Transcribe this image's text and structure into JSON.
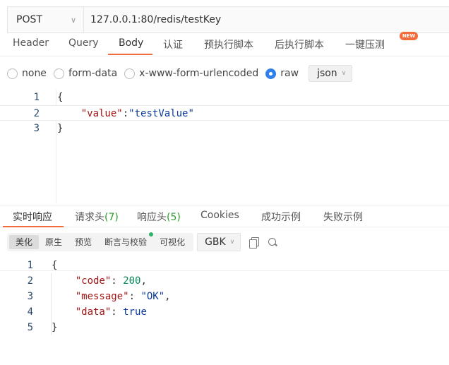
{
  "request": {
    "method": "POST",
    "url": "127.0.0.1:80/redis/testKey"
  },
  "request_tabs": [
    {
      "label": "Header"
    },
    {
      "label": "Query"
    },
    {
      "label": "Body"
    },
    {
      "label": "认证"
    },
    {
      "label": "预执行脚本"
    },
    {
      "label": "后执行脚本"
    },
    {
      "label": "一键压测"
    }
  ],
  "new_badge": "NEW",
  "body_types": [
    {
      "label": "none"
    },
    {
      "label": "form-data"
    },
    {
      "label": "x-www-form-urlencoded"
    },
    {
      "label": "raw"
    }
  ],
  "body_format": "json",
  "request_body_lines": [
    "1",
    "2",
    "3"
  ],
  "request_body": {
    "open": "{",
    "key": "\"value\"",
    "colon": ":",
    "value": "\"testValue\"",
    "close": "}"
  },
  "response_tabs": {
    "realtime": "实时响应",
    "req_headers": "请求头",
    "req_headers_count": "(7)",
    "resp_headers": "响应头",
    "resp_headers_count": "(5)",
    "cookies": "Cookies",
    "success_example": "成功示例",
    "fail_example": "失败示例"
  },
  "view_modes": [
    {
      "label": "美化"
    },
    {
      "label": "原生"
    },
    {
      "label": "预览"
    },
    {
      "label": "断言与校验"
    },
    {
      "label": "可视化"
    }
  ],
  "charset": "GBK",
  "response_lines": [
    "1",
    "2",
    "3",
    "4",
    "5"
  ],
  "response_body": {
    "open": "{",
    "code_key": "\"code\"",
    "code_val": "200",
    "message_key": "\"message\"",
    "message_val": "\"OK\"",
    "data_key": "\"data\"",
    "data_val": "true",
    "close": "}"
  },
  "colors": {
    "accent": "#f26b3a",
    "radio_selected": "#2f80ed",
    "count_green": "#2a9d2a"
  }
}
